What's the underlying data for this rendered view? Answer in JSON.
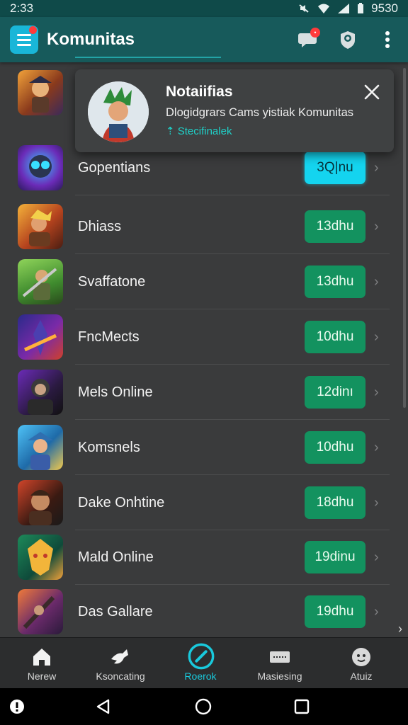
{
  "status_bar": {
    "time": "2:33",
    "battery": "9530"
  },
  "app_bar": {
    "title": "Komunitas",
    "icons": [
      "menu-logo-icon",
      "chat-notification-icon",
      "profile-badge-icon",
      "more-vert-icon"
    ]
  },
  "notification": {
    "title": "Notaiifias",
    "body": "Dlogidgrars Cams yistiak Komunitas",
    "link": "⇡ Stecifinalek",
    "icons": [
      "avatar",
      "close-icon"
    ]
  },
  "list": {
    "rows": [
      {
        "name": "",
        "badge": ""
      },
      {
        "name": "Gopentians",
        "badge": "3Q|nu"
      },
      {
        "name": "Dhiass",
        "badge": "13dhu"
      },
      {
        "name": "Svaffatone",
        "badge": "13dhu"
      },
      {
        "name": "FncMects",
        "badge": "10dhu"
      },
      {
        "name": "Mels Online",
        "badge": "12dinı"
      },
      {
        "name": "Komsnels",
        "badge": "10dhu"
      },
      {
        "name": "Dake Onhtine",
        "badge": "18dhu"
      },
      {
        "name": "Mald Online",
        "badge": "19dinu"
      },
      {
        "name": "Das Gallare",
        "badge": "19dhu"
      }
    ]
  },
  "bottom_nav": {
    "items": [
      {
        "label": "Nerew",
        "icon": "home-icon"
      },
      {
        "label": "Ksoncating",
        "icon": "bird-icon"
      },
      {
        "label": "Roerok",
        "icon": "edit-circle-icon"
      },
      {
        "label": "Masiesing",
        "icon": "keyboard-icon"
      },
      {
        "label": "Atuiz",
        "icon": "face-icon"
      }
    ],
    "active_index": 2
  },
  "colors": {
    "accent": "#19c9dc",
    "badge_green": "#13925f",
    "appbar": "#175a5b"
  }
}
